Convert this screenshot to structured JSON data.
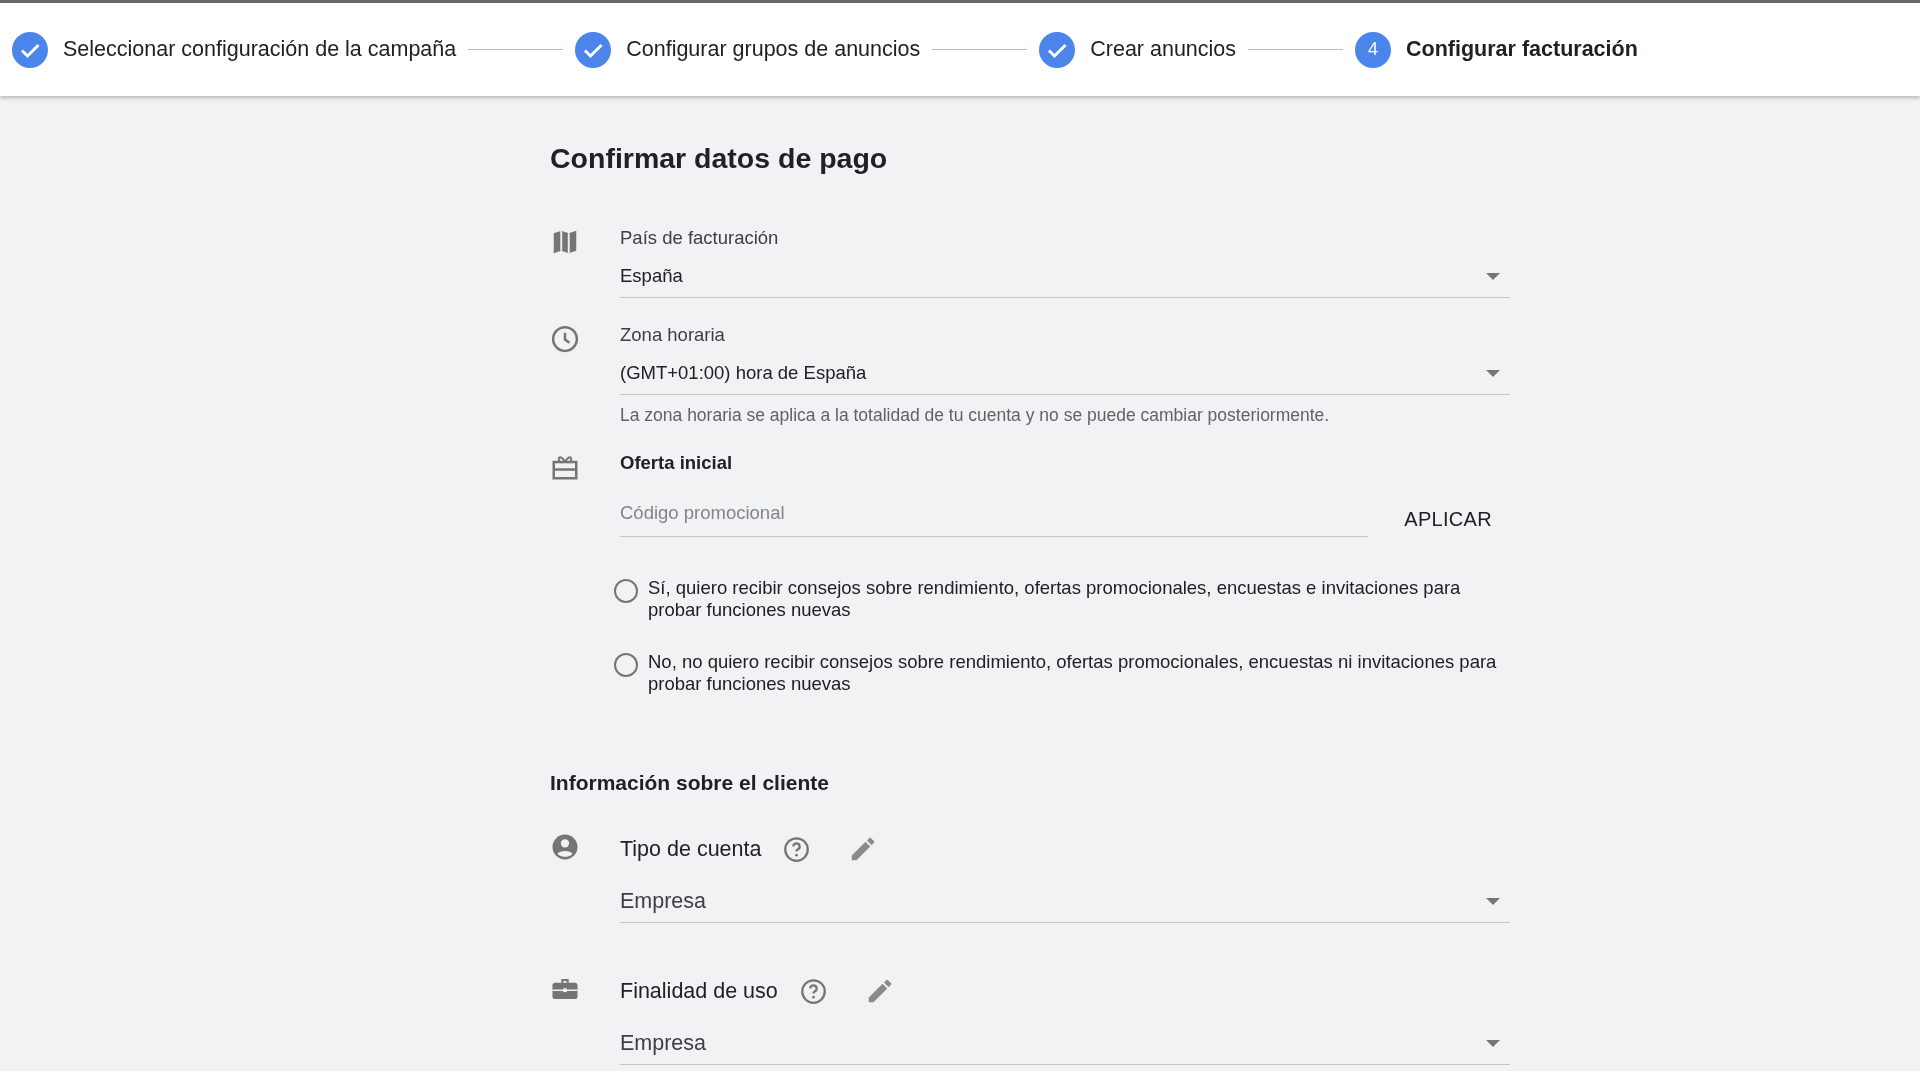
{
  "stepper": [
    {
      "label": "Seleccionar configuración de la campaña",
      "completed": true,
      "selected": false
    },
    {
      "label": "Configurar grupos de anuncios",
      "completed": true,
      "selected": false
    },
    {
      "label": "Crear anuncios",
      "completed": true,
      "selected": false
    },
    {
      "number": "4",
      "label": "Configurar facturación",
      "completed": false,
      "selected": true
    }
  ],
  "payment": {
    "title": "Confirmar datos de pago",
    "fields": [
      {
        "kind": "select",
        "label": "País de facturación",
        "value": "España"
      },
      {
        "kind": "select",
        "label": "Zona horaria",
        "value": "(GMT+01:00) hora de España",
        "hint": "La zona horaria se aplica a la totalidad de tu cuenta y no se puede cambiar posteriormente."
      },
      {
        "kind": "promo",
        "label": "Oferta inicial",
        "placeholder": "Código promocional",
        "button": "APLICAR"
      }
    ],
    "options": [
      {
        "label": "Sí, quiero recibir consejos sobre rendimiento, ofertas promocionales, encuestas e invitaciones para probar funciones nuevas",
        "selected": false
      },
      {
        "label": "No, no quiero recibir consejos sobre rendimiento, ofertas promocionales, encuestas ni invitaciones para probar funciones nuevas",
        "selected": false
      }
    ]
  },
  "client": {
    "title": "Información sobre el cliente",
    "fields": [
      {
        "label": "Tipo de cuenta",
        "value": "Empresa"
      },
      {
        "label": "Finalidad de uso",
        "value": "Empresa"
      }
    ]
  }
}
